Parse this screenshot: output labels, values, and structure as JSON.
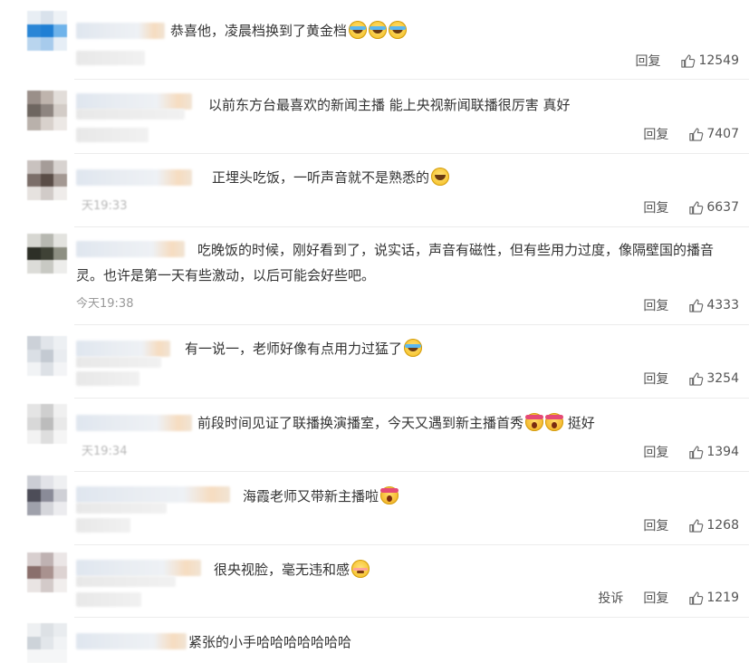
{
  "labels": {
    "reply": "回复",
    "report": "投诉"
  },
  "comments": [
    {
      "text": "恭喜他，凌晨档换到了黄金档",
      "time": "",
      "likes": "12549"
    },
    {
      "text": "以前东方台最喜欢的新闻主播 能上央视新闻联播很厉害 真好",
      "time": "",
      "likes": "7407"
    },
    {
      "text": "正埋头吃饭，一听声音就不是熟悉的",
      "time": "天19:33",
      "likes": "6637"
    },
    {
      "text": "吃晚饭的时候，刚好看到了，说实话，声音有磁性，但有些用力过度，像隔壁国的播音",
      "text2": "灵。也许是第一天有些激动，以后可能会好些吧。",
      "time": "今天19:38",
      "likes": "4333"
    },
    {
      "text": "有一说一，老师好像有点用力过猛了",
      "time": "",
      "likes": "3254"
    },
    {
      "text": "前段时间见证了联播换演播室，今天又遇到新主播首秀",
      "text_tail": "挺好",
      "time": "天19:34",
      "likes": "1394"
    },
    {
      "text": "海霞老师又带新主播啦",
      "time": "",
      "likes": "1268"
    },
    {
      "text": "很央视脸，毫无违和感",
      "time": "",
      "likes": "1219"
    },
    {
      "text": "紧张的小手哈哈哈哈哈哈哈",
      "time": "",
      "likes": ""
    }
  ]
}
